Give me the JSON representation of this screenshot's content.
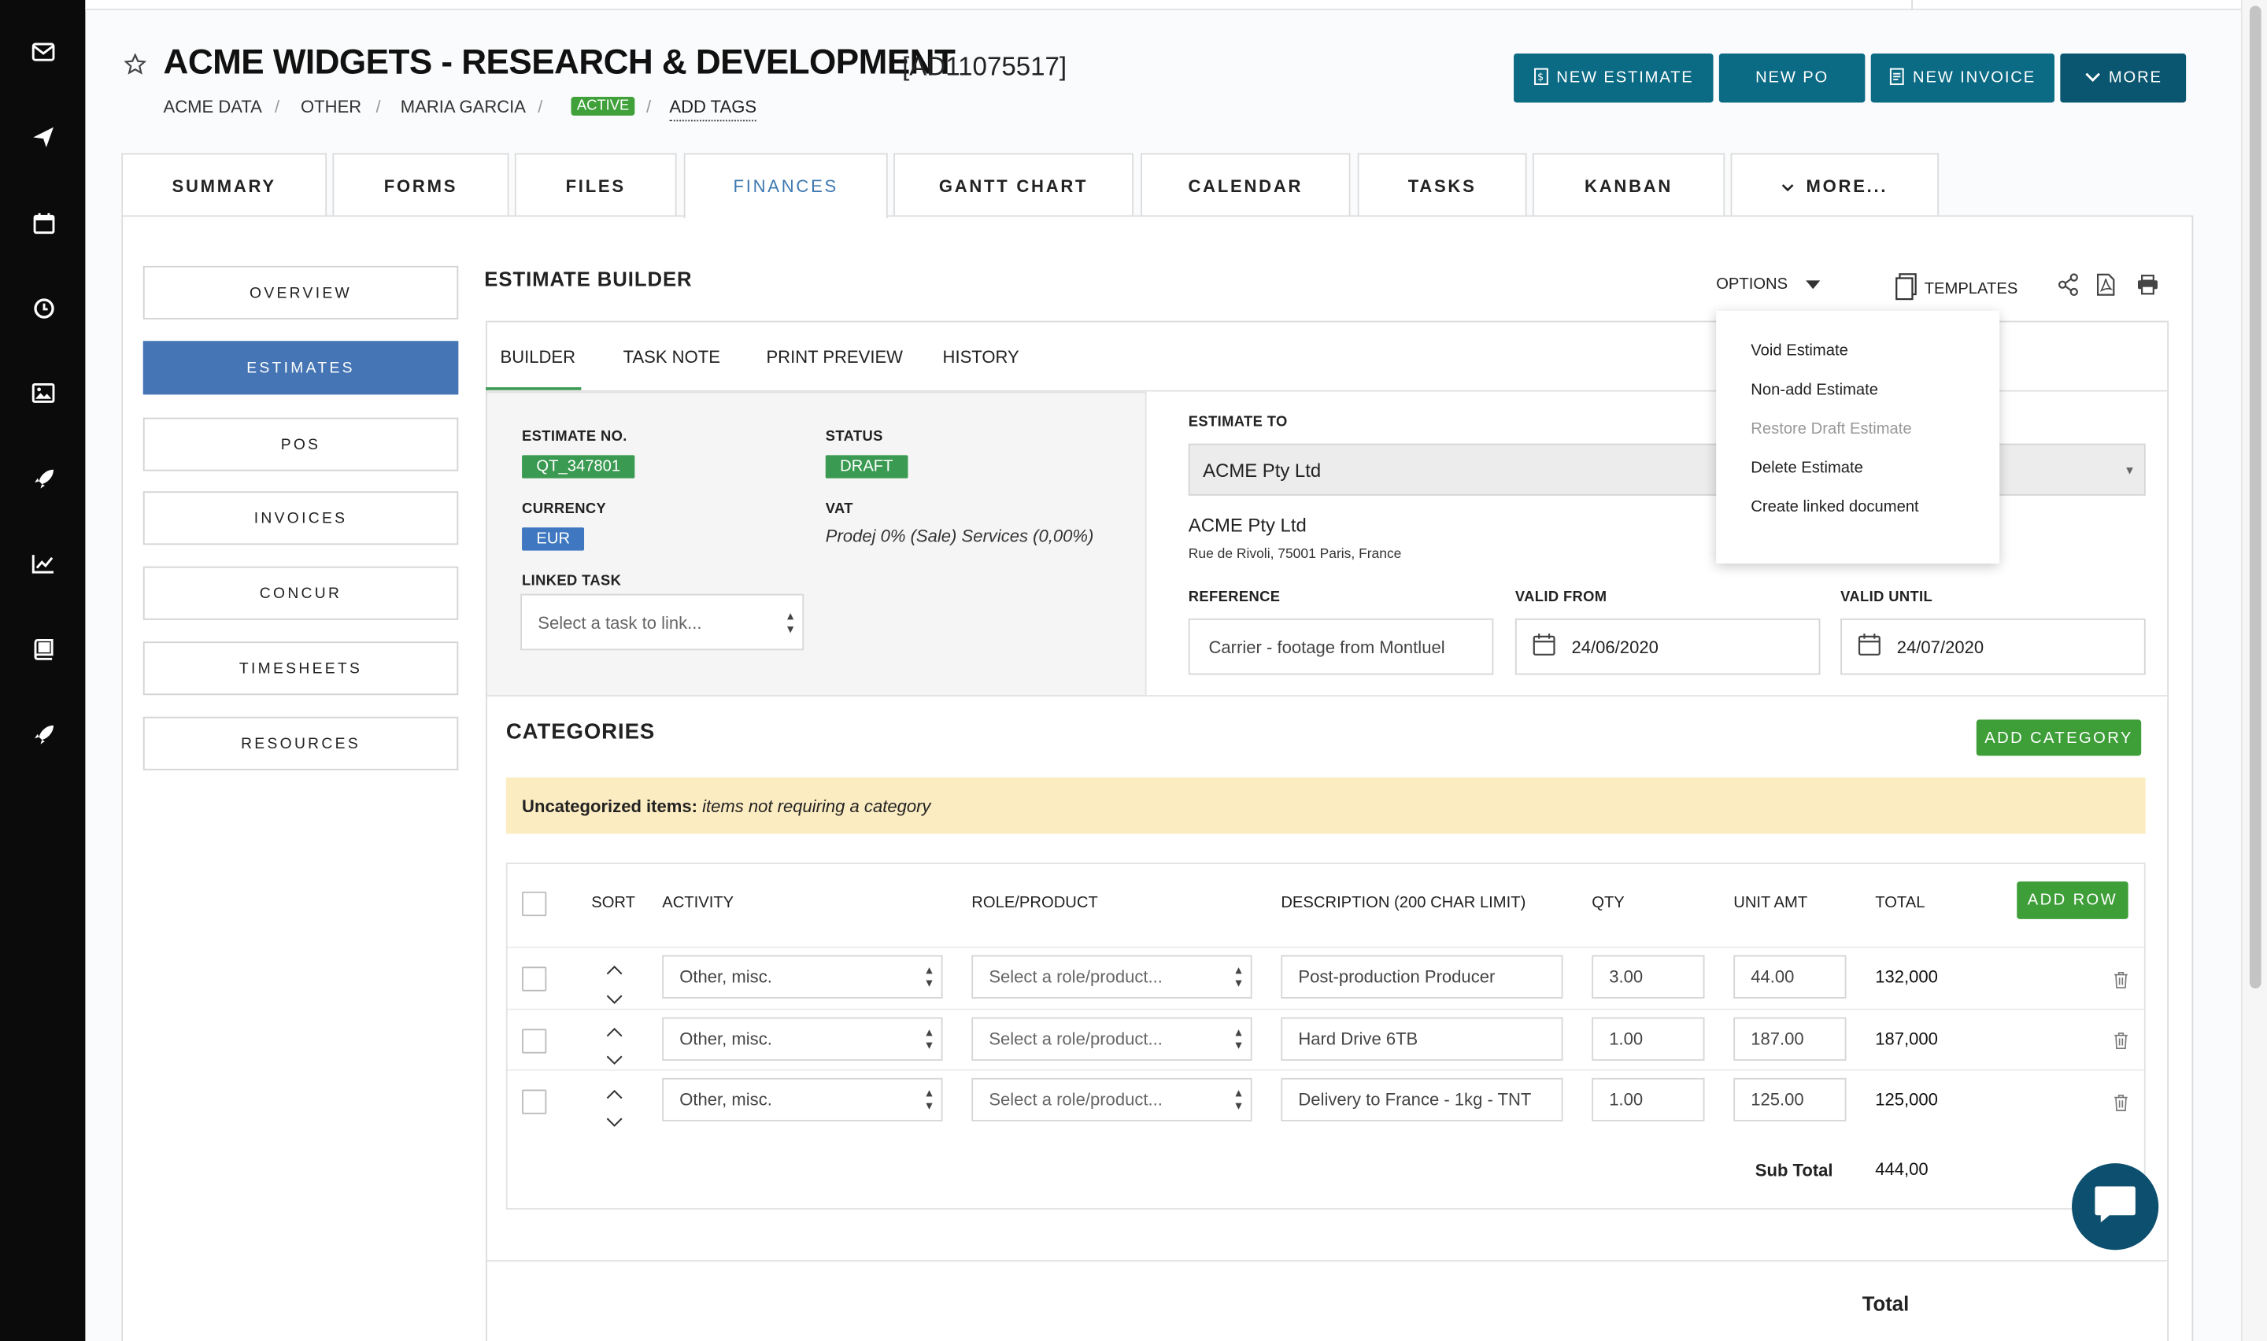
{
  "project": {
    "title": "ACME WIDGETS - RESEARCH & DEVELOPMENT",
    "code": "[AD11075517]",
    "breadcrumb": [
      "ACME DATA",
      "OTHER",
      "MARIA GARCIA"
    ],
    "status_badge": "ACTIVE",
    "add_tags": "ADD TAGS"
  },
  "toolbar": {
    "new_estimate": "NEW ESTIMATE",
    "new_po": "NEW PO",
    "new_invoice": "NEW INVOICE",
    "more": "MORE"
  },
  "tabs": [
    "SUMMARY",
    "FORMS",
    "FILES",
    "FINANCES",
    "GANTT CHART",
    "CALENDAR",
    "TASKS",
    "KANBAN",
    "MORE..."
  ],
  "active_tab": "FINANCES",
  "left_nav": [
    "OVERVIEW",
    "ESTIMATES",
    "POS",
    "INVOICES",
    "CONCUR",
    "TIMESHEETS",
    "RESOURCES"
  ],
  "active_nav": "ESTIMATES",
  "builder": {
    "title": "ESTIMATE BUILDER",
    "options": "OPTIONS",
    "templates": "TEMPLATES",
    "subtabs": [
      "BUILDER",
      "TASK NOTE",
      "PRINT PREVIEW",
      "HISTORY"
    ],
    "options_menu": [
      "Void Estimate",
      "Non-add Estimate",
      "Restore Draft Estimate",
      "Delete Estimate",
      "Create linked document"
    ],
    "options_menu_disabled": "Restore Draft Estimate"
  },
  "estimate": {
    "no_label": "ESTIMATE NO.",
    "no": "QT_347801",
    "status_label": "STATUS",
    "status": "DRAFT",
    "currency_label": "CURRENCY",
    "currency": "EUR",
    "vat_label": "VAT",
    "vat": "Prodej 0% (Sale) Services (0,00%)",
    "linked_task_label": "LINKED TASK",
    "linked_task_placeholder": "Select a task to link...",
    "to_label": "ESTIMATE TO",
    "to_value": "ACME Pty Ltd",
    "company_name": "ACME Pty Ltd",
    "company_address": "Rue de Rivoli, 75001 Paris, France",
    "reference_label": "REFERENCE",
    "reference": "Carrier - footage from Montluel",
    "valid_from_label": "VALID FROM",
    "valid_from": "24/06/2020",
    "valid_until_label": "VALID UNTIL",
    "valid_until": "24/07/2020"
  },
  "categories": {
    "title": "CATEGORIES",
    "add_category": "ADD CATEGORY",
    "banner_bold": "Uncategorized items:",
    "banner_text": "items not requiring a category",
    "add_row": "ADD ROW",
    "columns": [
      "SORT",
      "ACTIVITY",
      "ROLE/PRODUCT",
      "DESCRIPTION (200 CHAR LIMIT)",
      "QTY",
      "UNIT AMT",
      "TOTAL"
    ],
    "rows": [
      {
        "activity": "Other, misc.",
        "role": "Select a role/product...",
        "description": "Post-production Producer",
        "qty": "3.00",
        "unit": "44.00",
        "total": "132,000"
      },
      {
        "activity": "Other, misc.",
        "role": "Select a role/product...",
        "description": "Hard Drive 6TB",
        "qty": "1.00",
        "unit": "187.00",
        "total": "187,000"
      },
      {
        "activity": "Other, misc.",
        "role": "Select a role/product...",
        "description": "Delivery to France - 1kg - TNT",
        "qty": "1.00",
        "unit": "125.00",
        "total": "125,000"
      }
    ],
    "subtotal_label": "Sub Total",
    "subtotal": "444,00",
    "total_label": "Total"
  },
  "colors": {
    "sidebar": "#0b0b0c",
    "toolbar_button": "#0b6a84",
    "active_nav": "#4575b4",
    "green": "#3e9e38",
    "banner": "#fcecc2",
    "chat": "#0d4f6e"
  }
}
